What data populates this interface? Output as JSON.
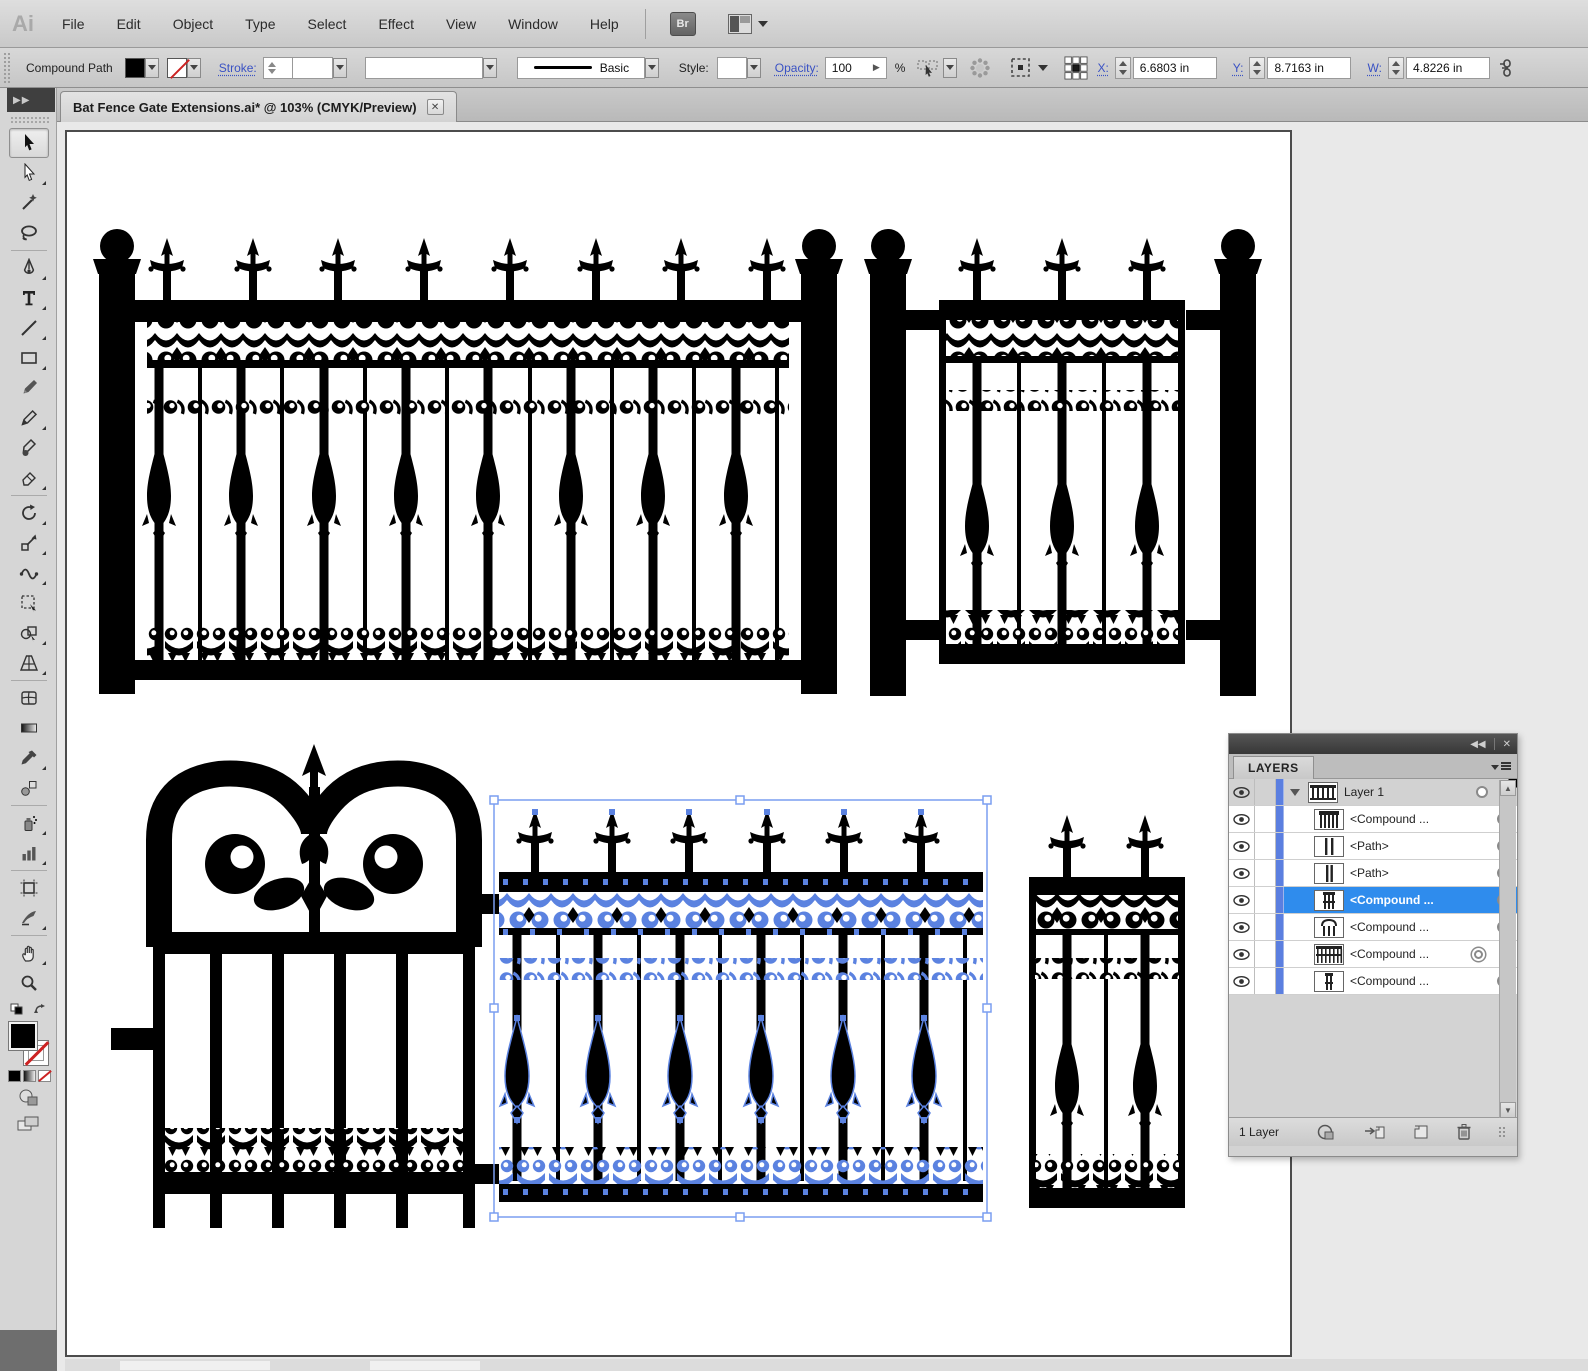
{
  "menubar": {
    "logo": "Ai",
    "items": [
      "File",
      "Edit",
      "Object",
      "Type",
      "Select",
      "Effect",
      "View",
      "Window",
      "Help"
    ],
    "bridge_label": "Br"
  },
  "control_bar": {
    "selection_label": "Compound Path",
    "stroke_label": "Stroke:",
    "width_profile_label": "Basic",
    "style_label": "Style:",
    "opacity_label": "Opacity:",
    "opacity_value": "100",
    "percent_label": "%",
    "x_label": "X:",
    "x_value": "6.6803 in",
    "y_label": "Y:",
    "y_value": "8.7163 in",
    "w_label": "W:",
    "w_value": "4.8226 in"
  },
  "document_tab": {
    "title": "Bat Fence Gate Extensions.ai* @ 103% (CMYK/Preview)",
    "close_glyph": "✕"
  },
  "icons": {
    "dock_collapse": "▶▶",
    "panel_collapse": "◀◀",
    "panel_close": "✕",
    "scroll_up": "▲",
    "scroll_down": "▼"
  },
  "layers_panel": {
    "title": "LAYERS",
    "rows": [
      {
        "label": "Layer 1"
      },
      {
        "label": "<Compound ..."
      },
      {
        "label": "<Path>"
      },
      {
        "label": "<Path>"
      },
      {
        "label": "<Compound ..."
      },
      {
        "label": "<Compound ..."
      },
      {
        "label": "<Compound ..."
      },
      {
        "label": "<Compound ..."
      }
    ],
    "status": "1 Layer"
  },
  "colors": {
    "selection_blue": "#5b82e0",
    "row_highlight": "#2f8ced",
    "artwork_black": "#000000"
  }
}
